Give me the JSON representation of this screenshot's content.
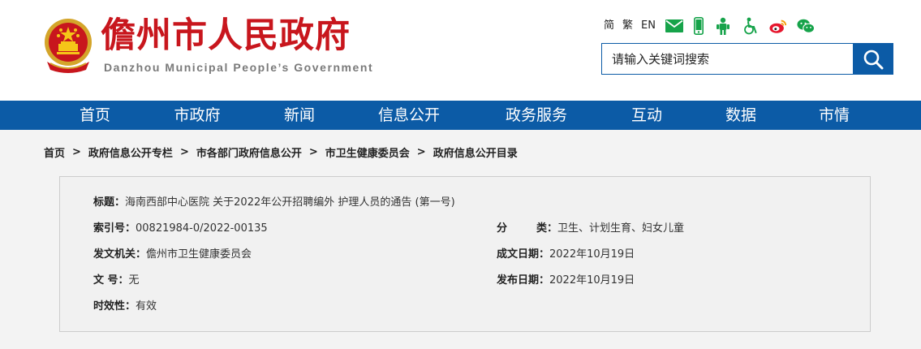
{
  "header": {
    "title": "儋州市人民政府",
    "subtitle": "Danzhou Municipal People’s Government",
    "tools": {
      "simplified": "简",
      "traditional": "繁",
      "english": "EN",
      "icons": [
        "email-icon",
        "mobile-icon",
        "elder-care-icon",
        "accessibility-icon",
        "weibo-icon",
        "wechat-icon"
      ]
    },
    "search": {
      "placeholder": "请输入关键词搜索"
    }
  },
  "nav": {
    "items": [
      "首页",
      "市政府",
      "新闻",
      "信息公开",
      "政务服务",
      "互动",
      "数据",
      "市情"
    ]
  },
  "breadcrumb": [
    "首页",
    "政府信息公开专栏",
    "市各部门政府信息公开",
    "市卫生健康委员会",
    "政府信息公开目录"
  ],
  "breadcrumb_separator": ">",
  "info": {
    "title_label": "标题：",
    "title_value": "海南西部中心医院 关于2022年公开招聘编外 护理人员的通告 (第一号)",
    "index_label": "索引号：",
    "index_value": "00821984-0/2022-00135",
    "category_label": "分类",
    "category_colon": "：",
    "category_value": "卫生、计划生育、妇女儿童",
    "issuer_label": "发文机关：",
    "issuer_value": "儋州市卫生健康委员会",
    "created_label": "成文日期：",
    "created_value": "2022年10月19日",
    "docno_label": "文 号：",
    "docno_value": "无",
    "published_label": "发布日期：",
    "published_value": "2022年10月19日",
    "validity_label": "时效性：",
    "validity_value": "有效"
  },
  "colors": {
    "brand_red": "#c8161d",
    "nav_blue": "#0c5ba6",
    "icon_green": "#16a34a"
  }
}
